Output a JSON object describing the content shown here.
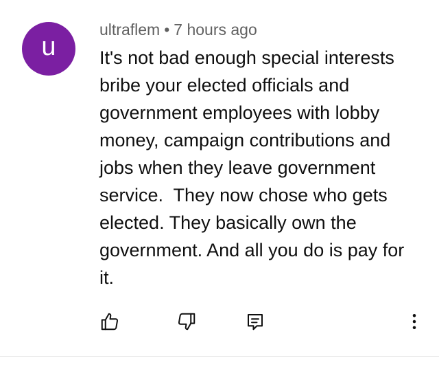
{
  "comment": {
    "avatar_letter": "u",
    "avatar_color": "#7b1fa2",
    "author": "ultraflem",
    "separator": "•",
    "timestamp": "7 hours ago",
    "text": "It's not bad enough special interests bribe your elected officials and government employees with lobby money, campaign contributions and jobs when they leave government service.  They now chose who gets elected. They basically own the government. And all you do is pay for it."
  },
  "actions": {
    "like_icon": "thumb-up-icon",
    "dislike_icon": "thumb-down-icon",
    "reply_icon": "comment-reply-icon",
    "more_icon": "more-vertical-icon"
  }
}
